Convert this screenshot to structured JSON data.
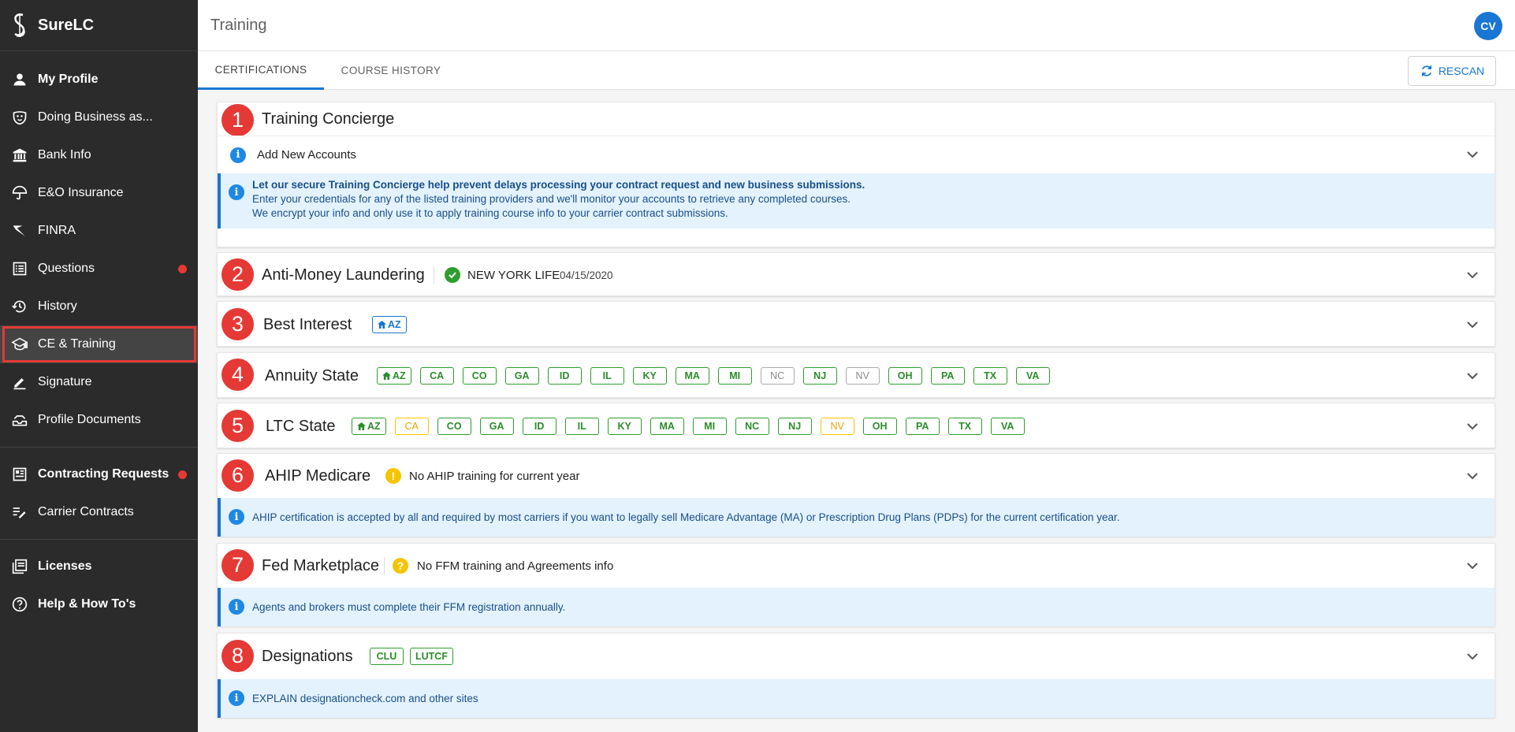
{
  "app": {
    "name": "SureLC"
  },
  "header": {
    "title": "Training",
    "avatar_initials": "CV"
  },
  "sidebar": {
    "items": [
      {
        "label": "My Profile",
        "icon": "person-icon"
      },
      {
        "label": "Doing Business as...",
        "icon": "mask-icon"
      },
      {
        "label": "Bank Info",
        "icon": "bank-icon"
      },
      {
        "label": "E&O Insurance",
        "icon": "umbrella-icon"
      },
      {
        "label": "FINRA",
        "icon": "finra-icon"
      },
      {
        "label": "Questions",
        "icon": "list-icon"
      },
      {
        "label": "History",
        "icon": "history-icon"
      },
      {
        "label": "CE & Training",
        "icon": "school-icon"
      },
      {
        "label": "Signature",
        "icon": "pen-icon"
      },
      {
        "label": "Profile Documents",
        "icon": "tray-icon"
      }
    ],
    "items2": [
      {
        "label": "Contracting Requests",
        "icon": "dashboard-icon"
      },
      {
        "label": "Carrier Contracts",
        "icon": "edit-list-icon"
      }
    ],
    "items3": [
      {
        "label": "Licenses",
        "icon": "licenses-icon"
      },
      {
        "label": "Help & How To's",
        "icon": "help-icon"
      }
    ]
  },
  "tabs": [
    {
      "label": "CERTIFICATIONS"
    },
    {
      "label": "COURSE HISTORY"
    }
  ],
  "toolbar": {
    "rescan_label": "RESCAN"
  },
  "sections": {
    "concierge": {
      "number": "1",
      "title": "Training Concierge",
      "add_accounts": "Add New Accounts",
      "banner_line1": "Let our secure Training Concierge help prevent delays processing your contract request and new business submissions.",
      "banner_line2": "Enter your credentials for any of the listed training providers and we'll monitor your accounts to retrieve any completed courses.",
      "banner_line3": "We encrypt your info and only use it to apply training course info to your carrier contract submissions."
    },
    "aml": {
      "number": "2",
      "title": "Anti-Money Laundering",
      "carrier": "NEW YORK LIFE",
      "date": "04/15/2020"
    },
    "best_interest": {
      "number": "3",
      "title": "Best Interest",
      "chip": "AZ"
    },
    "annuity": {
      "number": "4",
      "title": "Annuity State",
      "chips": [
        {
          "s": "AZ",
          "st": "home"
        },
        {
          "s": "CA",
          "st": "green"
        },
        {
          "s": "CO",
          "st": "green"
        },
        {
          "s": "GA",
          "st": "green"
        },
        {
          "s": "ID",
          "st": "green"
        },
        {
          "s": "IL",
          "st": "green"
        },
        {
          "s": "KY",
          "st": "green"
        },
        {
          "s": "MA",
          "st": "green"
        },
        {
          "s": "MI",
          "st": "green"
        },
        {
          "s": "NC",
          "st": "grey"
        },
        {
          "s": "NJ",
          "st": "green"
        },
        {
          "s": "NV",
          "st": "grey"
        },
        {
          "s": "OH",
          "st": "green"
        },
        {
          "s": "PA",
          "st": "green"
        },
        {
          "s": "TX",
          "st": "green"
        },
        {
          "s": "VA",
          "st": "green"
        }
      ]
    },
    "ltc": {
      "number": "5",
      "title": "LTC State",
      "chips": [
        {
          "s": "AZ",
          "st": "home"
        },
        {
          "s": "CA",
          "st": "yellow"
        },
        {
          "s": "CO",
          "st": "green"
        },
        {
          "s": "GA",
          "st": "green"
        },
        {
          "s": "ID",
          "st": "green"
        },
        {
          "s": "IL",
          "st": "green"
        },
        {
          "s": "KY",
          "st": "green"
        },
        {
          "s": "MA",
          "st": "green"
        },
        {
          "s": "MI",
          "st": "green"
        },
        {
          "s": "NC",
          "st": "green"
        },
        {
          "s": "NJ",
          "st": "green"
        },
        {
          "s": "NV",
          "st": "yellow"
        },
        {
          "s": "OH",
          "st": "green"
        },
        {
          "s": "PA",
          "st": "green"
        },
        {
          "s": "TX",
          "st": "green"
        },
        {
          "s": "VA",
          "st": "green"
        }
      ]
    },
    "ahip": {
      "number": "6",
      "title": "AHIP Medicare",
      "status": "No AHIP training for current year",
      "banner": "AHIP certification is accepted by all and required by most carriers if you want to legally sell Medicare Advantage (MA) or Prescription Drug Plans (PDPs) for the current certification year."
    },
    "ffm": {
      "number": "7",
      "title": "Fed Marketplace",
      "status": "No FFM training and Agreements info",
      "banner": "Agents and brokers must complete their FFM registration annually."
    },
    "designations": {
      "number": "8",
      "title": "Designations",
      "chips": [
        "CLU",
        "LUTCF"
      ],
      "banner": "EXPLAIN designationcheck.com and other sites"
    }
  },
  "colors": {
    "accent": "#1976d2",
    "alert": "#e53935",
    "success": "#2e9d2e",
    "warning": "#f5c400",
    "sidebar": "#2b2b2b"
  }
}
